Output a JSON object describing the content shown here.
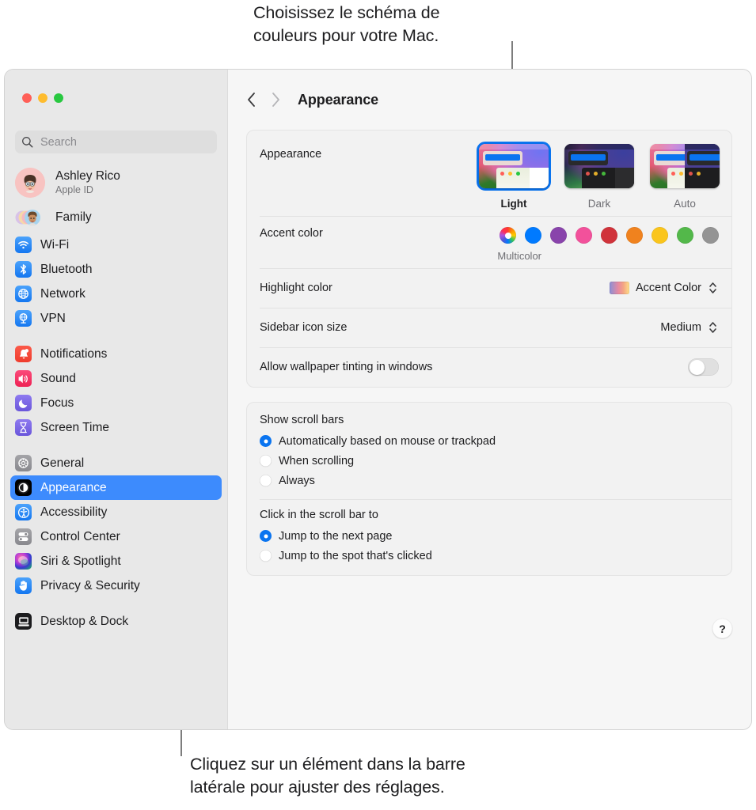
{
  "annotations": {
    "top": "Choisissez le schéma de\ncouleurs pour votre Mac.",
    "bottom": "Cliquez sur un élément dans la barre\nlatérale pour ajuster des réglages."
  },
  "window": {
    "traffic_lights": {
      "close": "close-button",
      "minimize": "minimize-button",
      "maximize": "maximize-button"
    }
  },
  "search": {
    "placeholder": "Search",
    "value": ""
  },
  "account": {
    "name": "Ashley Rico",
    "subtitle": "Apple ID",
    "family_label": "Family"
  },
  "sidebar": {
    "groups": [
      {
        "items": [
          {
            "label": "Wi-Fi",
            "icon": "wifi-icon",
            "selected": false
          },
          {
            "label": "Bluetooth",
            "icon": "bluetooth-icon",
            "selected": false
          },
          {
            "label": "Network",
            "icon": "network-icon",
            "selected": false
          },
          {
            "label": "VPN",
            "icon": "vpn-icon",
            "selected": false
          }
        ]
      },
      {
        "items": [
          {
            "label": "Notifications",
            "icon": "notifications-icon",
            "selected": false
          },
          {
            "label": "Sound",
            "icon": "sound-icon",
            "selected": false
          },
          {
            "label": "Focus",
            "icon": "focus-icon",
            "selected": false
          },
          {
            "label": "Screen Time",
            "icon": "screen-time-icon",
            "selected": false
          }
        ]
      },
      {
        "items": [
          {
            "label": "General",
            "icon": "general-icon",
            "selected": false
          },
          {
            "label": "Appearance",
            "icon": "appearance-icon",
            "selected": true
          },
          {
            "label": "Accessibility",
            "icon": "accessibility-icon",
            "selected": false
          },
          {
            "label": "Control Center",
            "icon": "control-center-icon",
            "selected": false
          },
          {
            "label": "Siri & Spotlight",
            "icon": "siri-icon",
            "selected": false
          },
          {
            "label": "Privacy & Security",
            "icon": "privacy-icon",
            "selected": false
          }
        ]
      },
      {
        "items": [
          {
            "label": "Desktop & Dock",
            "icon": "desktop-dock-icon",
            "selected": false
          }
        ]
      }
    ]
  },
  "toolbar": {
    "back_icon": "chevron-left-icon",
    "forward_icon": "chevron-right-icon",
    "title": "Appearance"
  },
  "settings": {
    "appearance": {
      "label": "Appearance",
      "options": [
        {
          "caption": "Light",
          "selected": true
        },
        {
          "caption": "Dark",
          "selected": false
        },
        {
          "caption": "Auto",
          "selected": false
        }
      ]
    },
    "accent_color": {
      "label": "Accent color",
      "selected_name": "Multicolor",
      "swatches": [
        {
          "name": "Multicolor",
          "color": "multicolor",
          "selected": true
        },
        {
          "name": "Blue",
          "color": "#007aff",
          "selected": false
        },
        {
          "name": "Purple",
          "color": "#8944ab",
          "selected": false
        },
        {
          "name": "Pink",
          "color": "#f2519b",
          "selected": false
        },
        {
          "name": "Red",
          "color": "#d0333b",
          "selected": false
        },
        {
          "name": "Orange",
          "color": "#f0821e",
          "selected": false
        },
        {
          "name": "Yellow",
          "color": "#fac51c",
          "selected": false
        },
        {
          "name": "Green",
          "color": "#53b84a",
          "selected": false
        },
        {
          "name": "Graphite",
          "color": "#949494",
          "selected": false
        }
      ]
    },
    "highlight_color": {
      "label": "Highlight color",
      "value": "Accent Color"
    },
    "sidebar_icon_size": {
      "label": "Sidebar icon size",
      "value": "Medium"
    },
    "wallpaper_tinting": {
      "label": "Allow wallpaper tinting in windows",
      "enabled": false
    },
    "show_scroll_bars": {
      "label": "Show scroll bars",
      "options": [
        {
          "label": "Automatically based on mouse or trackpad",
          "selected": true
        },
        {
          "label": "When scrolling",
          "selected": false
        },
        {
          "label": "Always",
          "selected": false
        }
      ]
    },
    "click_scroll_bar": {
      "label": "Click in the scroll bar to",
      "options": [
        {
          "label": "Jump to the next page",
          "selected": true
        },
        {
          "label": "Jump to the spot that's clicked",
          "selected": false
        }
      ]
    },
    "help": {
      "label": "?"
    }
  }
}
